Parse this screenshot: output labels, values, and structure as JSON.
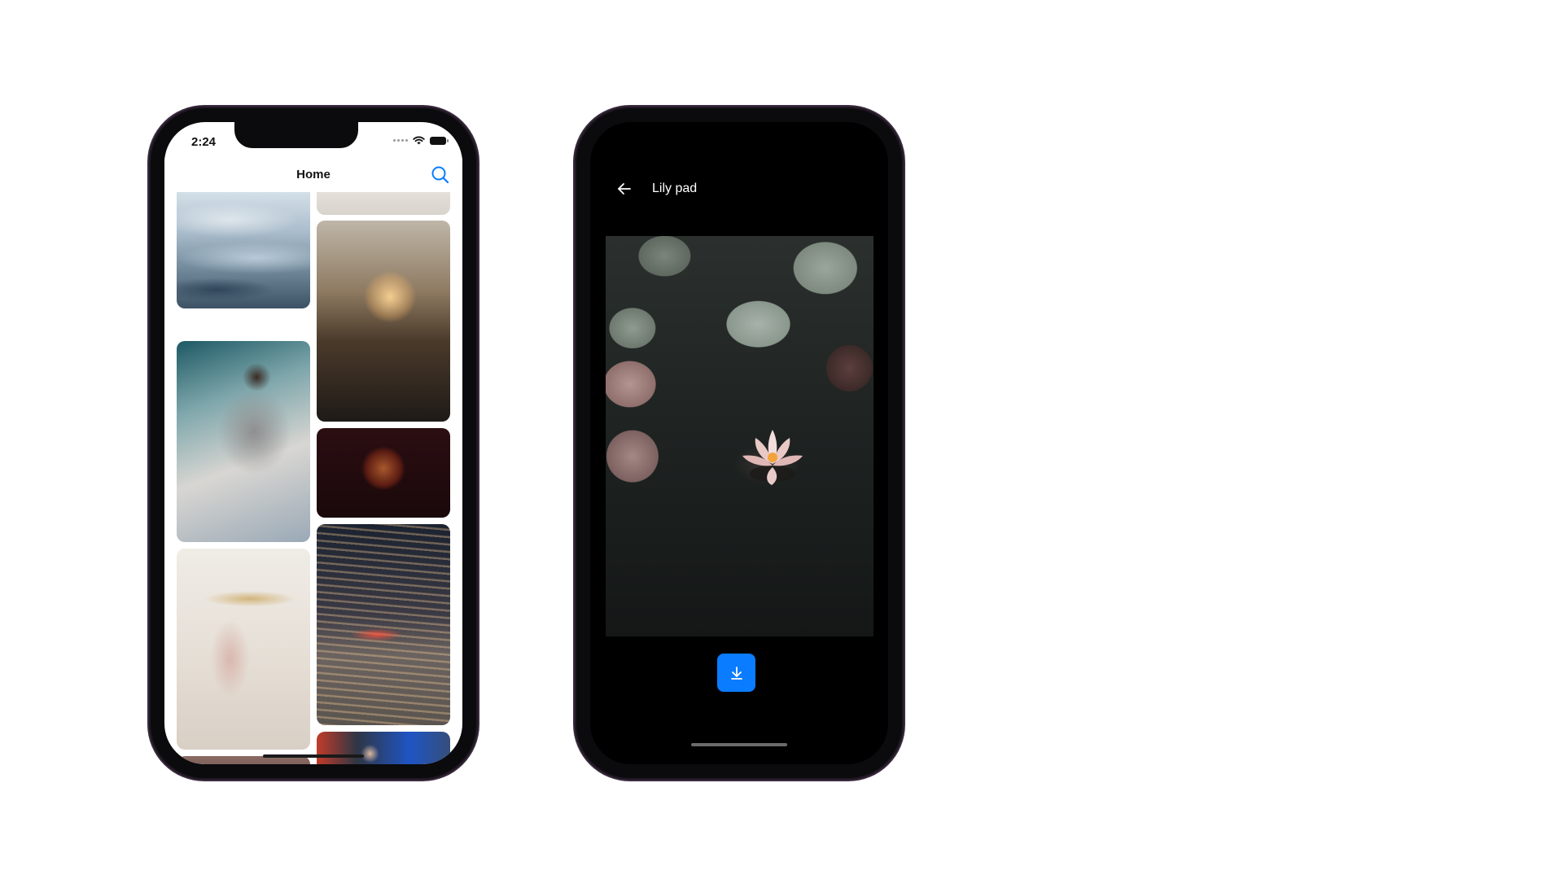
{
  "colors": {
    "accent": "#0a7cff",
    "phone_frame": "#0b0b0d",
    "detail_background": "#000000"
  },
  "home_screen": {
    "status_bar": {
      "time": "2:24",
      "icons": [
        "cellular-dots-icon",
        "wifi-icon",
        "battery-icon"
      ]
    },
    "nav": {
      "title": "Home",
      "search_icon": "search-icon"
    },
    "grid": {
      "photos": [
        {
          "name": "clouds-photo"
        },
        {
          "name": "partial-photo-top"
        },
        {
          "name": "building-sunset-photo"
        },
        {
          "name": "man-laptop-photo"
        },
        {
          "name": "mask-photo"
        },
        {
          "name": "birthday-girl-photo"
        },
        {
          "name": "night-street-photo"
        },
        {
          "name": "partial-photo-bottom-left"
        },
        {
          "name": "partial-photo-bottom-right"
        }
      ]
    }
  },
  "detail_screen": {
    "nav": {
      "back_icon": "arrow-left-icon",
      "title": "Lily pad"
    },
    "photo": {
      "name": "lily-pad-photo"
    },
    "action": {
      "icon": "download-icon"
    }
  }
}
